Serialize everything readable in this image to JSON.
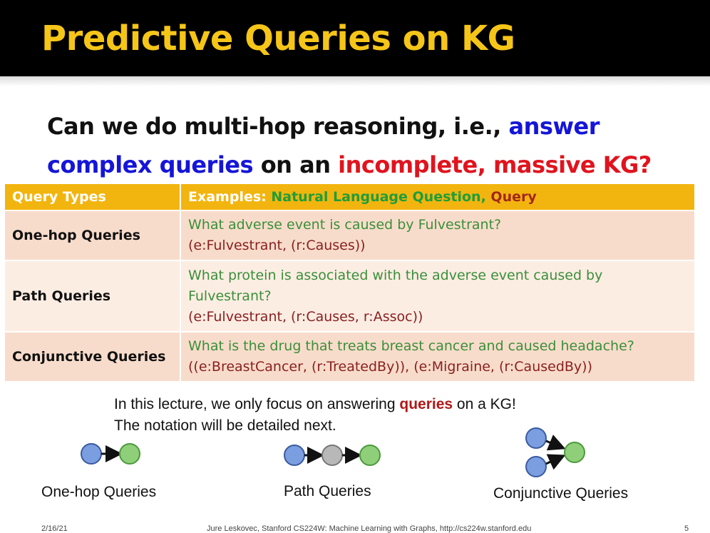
{
  "slide": {
    "title": "Predictive Queries on KG",
    "question": {
      "part1": "Can we do multi-hop reasoning, i.e., ",
      "part2": "answer complex queries",
      "part3": " on an ",
      "part4": "incomplete, massive KG?"
    }
  },
  "table": {
    "header_type": "Query Types",
    "header_examples": "Examples: ",
    "header_nlq": "Natural Language Question",
    "header_sep": ", ",
    "header_query": "Query",
    "rows": [
      {
        "type": "One-hop Queries",
        "question": "What adverse event is caused by Fulvestrant?",
        "query": "(e:Fulvestrant, (r:Causes))"
      },
      {
        "type": "Path Queries",
        "question": "What protein is associated with the adverse event caused by Fulvestrant?",
        "query": "(e:Fulvestrant, (r:Causes, r:Assoc))"
      },
      {
        "type": "Conjunctive Queries",
        "question": "What is the drug that treats breast cancer and caused headache?",
        "query": "((e:BreastCancer, (r:TreatedBy)), (e:Migraine, (r:CausedBy))"
      }
    ]
  },
  "note": {
    "line1_a": "In this lecture, we only focus on answering ",
    "line1_hl": "queries",
    "line1_b": " on a KG!",
    "line2": "The notation will be detailed next."
  },
  "diagrams": {
    "one_hop": "One-hop Queries",
    "path": "Path Queries",
    "conjunctive": "Conjunctive Queries"
  },
  "footer": {
    "date": "2/16/21",
    "credit": "Jure Leskovec, Stanford CS224W: Machine Learning with Graphs, http://cs224w.stanford.edu",
    "page": "5"
  },
  "colors": {
    "title": "#f5c518",
    "blue_highlight": "#1515d8",
    "red_highlight": "#e0141e",
    "table_header": "#f2b50f",
    "nlq_green": "#3a8f3a",
    "query_brown": "#8a2020",
    "node_blue": "#7b9ee0",
    "node_green": "#8fcf7a",
    "node_gray": "#b8b8b8"
  }
}
